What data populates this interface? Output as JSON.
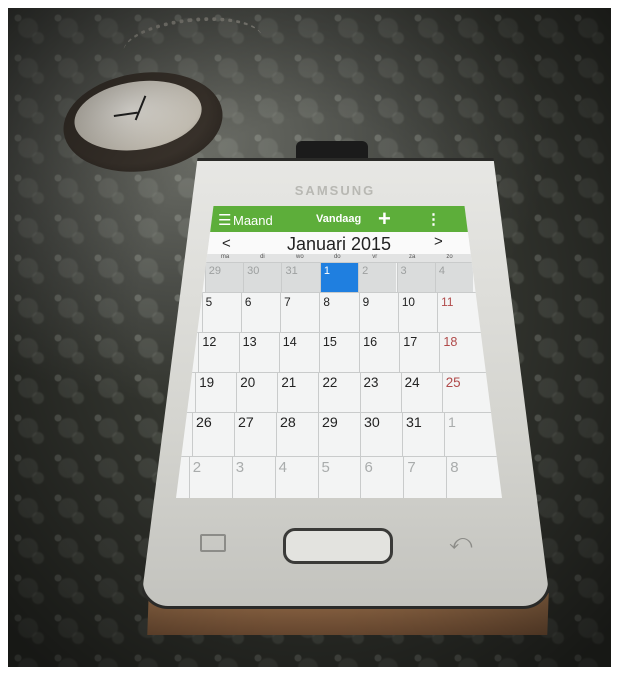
{
  "phone": {
    "brand": "SAMSUNG"
  },
  "calendar": {
    "view_label": "Maand",
    "today_label": "Vandaag",
    "add_label": "+",
    "more_label": "⋮",
    "menu_label": "☰",
    "prev_label": "<",
    "next_label": ">",
    "month_title": "Januari 2015",
    "weekday_headers": [
      "ma",
      "di",
      "wo",
      "do",
      "vr",
      "za",
      "zo"
    ],
    "weeks": [
      [
        "29",
        "30",
        "31",
        "1",
        "2",
        "3",
        "4"
      ],
      [
        "5",
        "6",
        "7",
        "8",
        "9",
        "10",
        "11"
      ],
      [
        "12",
        "13",
        "14",
        "15",
        "16",
        "17",
        "18"
      ],
      [
        "19",
        "20",
        "21",
        "22",
        "23",
        "24",
        "25"
      ],
      [
        "26",
        "27",
        "28",
        "29",
        "30",
        "31",
        "1"
      ],
      [
        "2",
        "3",
        "4",
        "5",
        "6",
        "7",
        "8"
      ]
    ],
    "selected_day": "1",
    "colors": {
      "header_green": "#5dae3a",
      "selected_blue": "#1f7fe0",
      "sunday_red": "#b04a4a"
    }
  },
  "navigation_icons": [
    "recent-apps-icon",
    "home-button",
    "back-icon"
  ]
}
